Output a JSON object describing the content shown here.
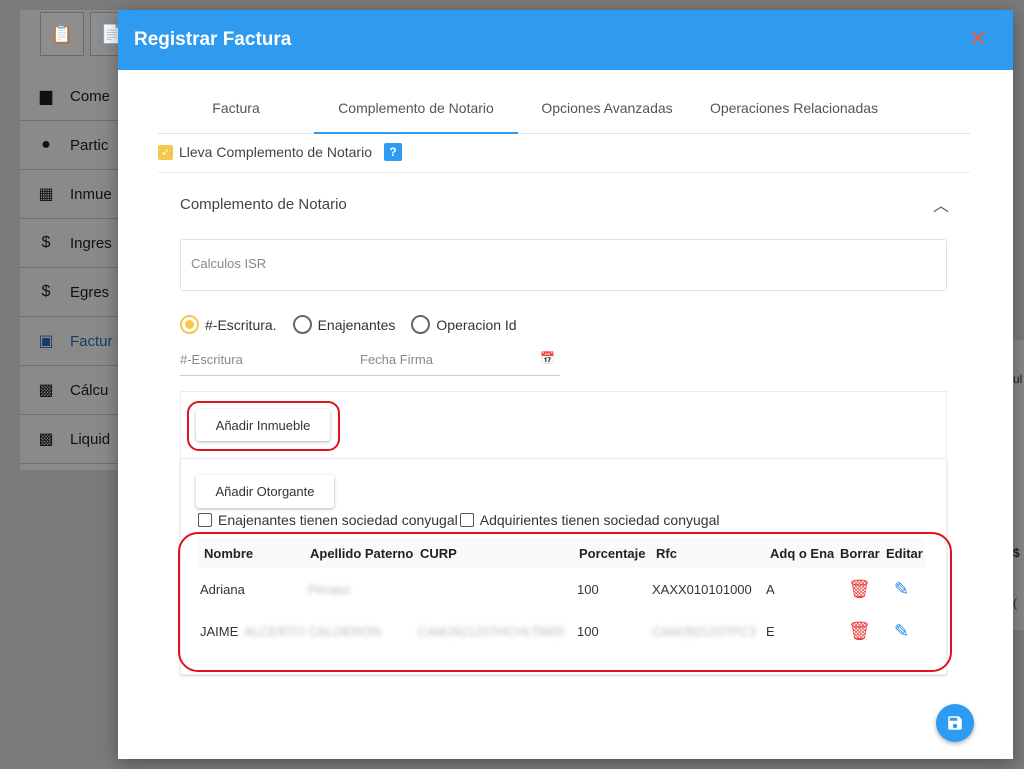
{
  "background": {
    "nav_items": [
      {
        "label": "Come",
        "icon": "comment-icon"
      },
      {
        "label": "Partic",
        "icon": "person-icon"
      },
      {
        "label": "Inmue",
        "icon": "building-icon"
      },
      {
        "label": "Ingres",
        "icon": "dollar-icon"
      },
      {
        "label": "Egres",
        "icon": "dollar-off-icon"
      },
      {
        "label": "Factur",
        "icon": "invoice-icon"
      },
      {
        "label": "Cálcu",
        "icon": "calculator-icon"
      },
      {
        "label": "Liquid",
        "icon": "calculator-icon"
      }
    ],
    "right_peek": [
      "ul",
      "$",
      "("
    ]
  },
  "modal": {
    "title": "Registrar Factura",
    "close": "✕"
  },
  "tabs": [
    {
      "label": "Factura",
      "active": false
    },
    {
      "label": "Complemento de Notario",
      "active": true
    },
    {
      "label": "Opciones Avanzadas",
      "active": false
    },
    {
      "label": "Operaciones Relacionadas",
      "active": false
    }
  ],
  "lleva_label": "Lleva Complemento de Notario",
  "help": "?",
  "section_title": "Complemento de Notario",
  "calc_label": "Calculos ISR",
  "radios": [
    {
      "label": "#-Escritura.",
      "selected": true
    },
    {
      "label": "Enajenantes",
      "selected": false
    },
    {
      "label": "Operacion Id",
      "selected": false
    }
  ],
  "fields": {
    "escritura_placeholder": "#-Escritura",
    "fecha_placeholder": "Fecha Firma"
  },
  "buttons": {
    "add_inmueble": "Añadir Inmueble",
    "add_otorgante": "Añadir Otorgante"
  },
  "checks": {
    "enajenantes": "Enajenantes tienen sociedad conyugal",
    "adquirientes": "Adquirientes tienen sociedad conyugal"
  },
  "table": {
    "headers": [
      "Nombre",
      "Apellido Paterno",
      "CURP",
      "Porcentaje",
      "Rfc",
      "Adq o Ena",
      "Borrar",
      "Editar"
    ],
    "rows": [
      {
        "nombre": "Adriana",
        "apellido": "Peraeo",
        "curp": "",
        "porcentaje": "100",
        "rfc": "XAXX010101000",
        "tipo": "A"
      },
      {
        "nombre": "JAIME",
        "apellido": "ALCERTO CALDERON",
        "curp": "CAMJ921207HCHLTM05",
        "porcentaje": "100",
        "rfc": "CAMJ921207PC3",
        "tipo": "E"
      }
    ]
  },
  "colors": {
    "header_blue": "#2f9bf0",
    "accent_yellow": "#f2c94c",
    "highlight_red": "#e1121d",
    "delete_red": "#e53935",
    "edit_blue": "#1e88e5"
  }
}
